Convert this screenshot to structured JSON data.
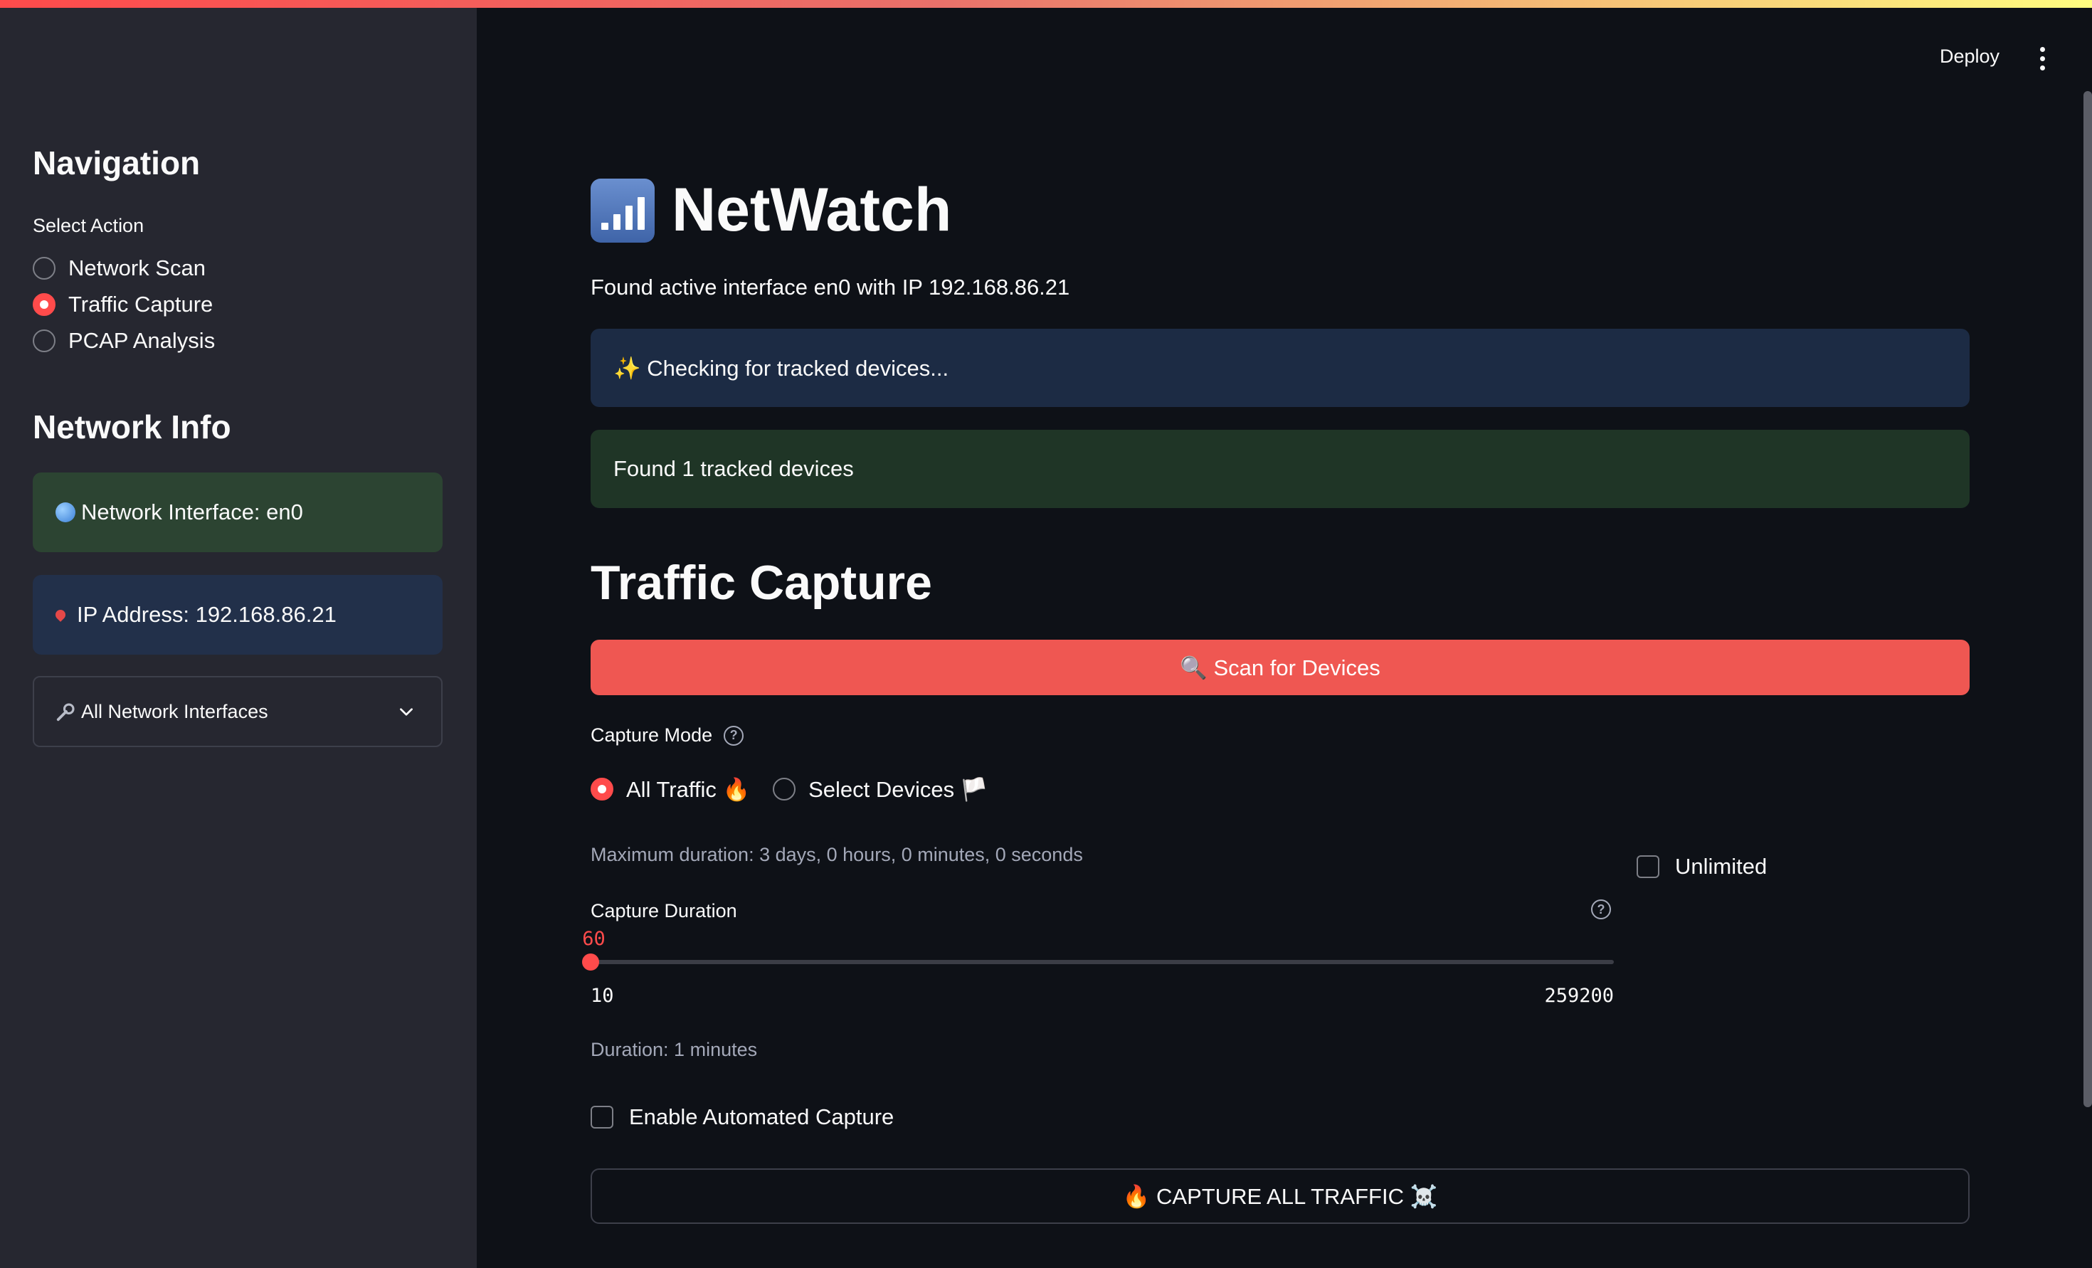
{
  "deploy_label": "Deploy",
  "sidebar": {
    "nav_title": "Navigation",
    "select_label": "Select Action",
    "actions": [
      {
        "label": "Network Scan",
        "selected": false
      },
      {
        "label": "Traffic Capture",
        "selected": true
      },
      {
        "label": "PCAP Analysis",
        "selected": false
      }
    ],
    "info_title": "Network Info",
    "interface_text": "Network Interface: en0",
    "ip_text": "IP Address: 192.168.86.21",
    "expander_label": "All Network Interfaces"
  },
  "main": {
    "title": "NetWatch",
    "found_interface": "Found active interface en0 with IP 192.168.86.21",
    "checking_text": "✨ Checking for tracked devices...",
    "found_devices": "Found 1 tracked devices",
    "section_title": "Traffic Capture",
    "scan_button": "🔍 Scan for Devices",
    "capture_mode_label": "Capture Mode",
    "modes": [
      {
        "label": "All Traffic 🔥",
        "selected": true
      },
      {
        "label": "Select Devices 🏳️",
        "selected": false
      }
    ],
    "max_duration": "Maximum duration: 3 days, 0 hours, 0 minutes, 0 seconds",
    "unlimited_label": "Unlimited",
    "duration_label": "Capture Duration",
    "slider": {
      "value": "60",
      "min": "10",
      "max": "259200",
      "value_num": 60,
      "min_num": 10,
      "max_num": 259200
    },
    "duration_text": "Duration: 1 minutes",
    "automated_label": "Enable Automated Capture",
    "capture_button": "🔥 CAPTURE ALL TRAFFIC ☠️"
  },
  "colors": {
    "accent": "#ff4b4b",
    "background": "#0e1117",
    "sidebar": "#262730"
  }
}
